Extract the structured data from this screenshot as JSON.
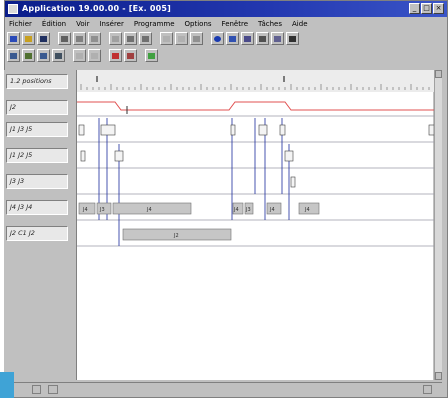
{
  "window": {
    "title": "Application 19.00.00 - [Ex. 005]"
  },
  "menu": [
    "Fichier",
    "Édition",
    "Voir",
    "Insérer",
    "Programme",
    "Options",
    "Fenêtre",
    "Tâches",
    "Aide"
  ],
  "ruler_label": "1.2 positions",
  "rows": [
    {
      "label": "J2"
    },
    {
      "label": "J1 J3 J5"
    },
    {
      "label": "J1 J2 J5"
    },
    {
      "label": "J3 J3"
    },
    {
      "label": "J4 J3 J4"
    },
    {
      "label": "J2 C1 J2"
    }
  ],
  "segments": {
    "row4": [
      "J4",
      "J3",
      "J4",
      "J4",
      "J3",
      "J4",
      "J4"
    ],
    "row5": [
      "J2"
    ]
  },
  "toolbar_icons": {
    "row1": [
      "new-icon",
      "open-icon",
      "save-icon",
      "print-icon",
      "cut-icon",
      "copy-icon",
      "paste-icon",
      "undo-icon",
      "redo-icon",
      "zoom-in-icon",
      "zoom-out-icon",
      "find-icon",
      "info-icon",
      "chart-icon",
      "grid-icon",
      "settings-icon",
      "select-icon",
      "pen-icon"
    ],
    "row2": [
      "cursor-icon",
      "move-icon",
      "insert-icon",
      "delete-icon",
      "align-icon",
      "measure-icon",
      "flag-icon",
      "stop-icon",
      "run-icon"
    ]
  },
  "colors": {
    "titlebar": "#0a1d8a",
    "trace_red": "#e05050",
    "marker_blue": "#1a2a9c"
  }
}
